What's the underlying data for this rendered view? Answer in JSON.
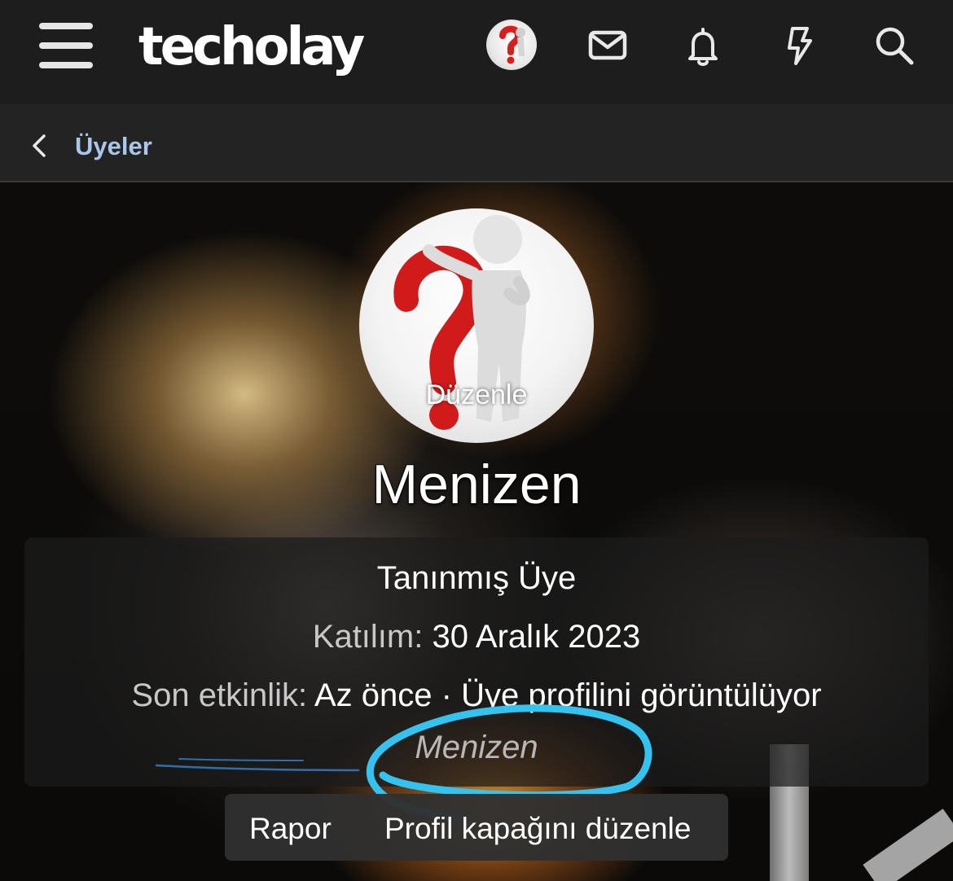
{
  "header": {
    "brand": "techolay",
    "icons": [
      "menu-icon",
      "avatar",
      "mail-icon",
      "bell-icon",
      "bolt-icon",
      "search-icon"
    ]
  },
  "breadcrumb": {
    "label": "Üyeler"
  },
  "profile": {
    "avatar_edit_label": "Düzenle",
    "username": "Menizen",
    "user_title": "Tanınmış Üye",
    "joined_label": "Katılım:",
    "joined_value": "30 Aralık 2023",
    "activity_label": "Son etkinlik:",
    "activity_time": "Az önce",
    "activity_separator": "·",
    "activity_text": "Üye profilini görüntülüyor",
    "activity_target": "Menizen"
  },
  "actions": {
    "report": "Rapor",
    "edit_cover": "Profil kapağını düzenle"
  },
  "colors": {
    "brand_text": "#ffffff",
    "breadcrumb_link": "#a9c7e8",
    "annotation_stroke": "#34c3ef"
  }
}
